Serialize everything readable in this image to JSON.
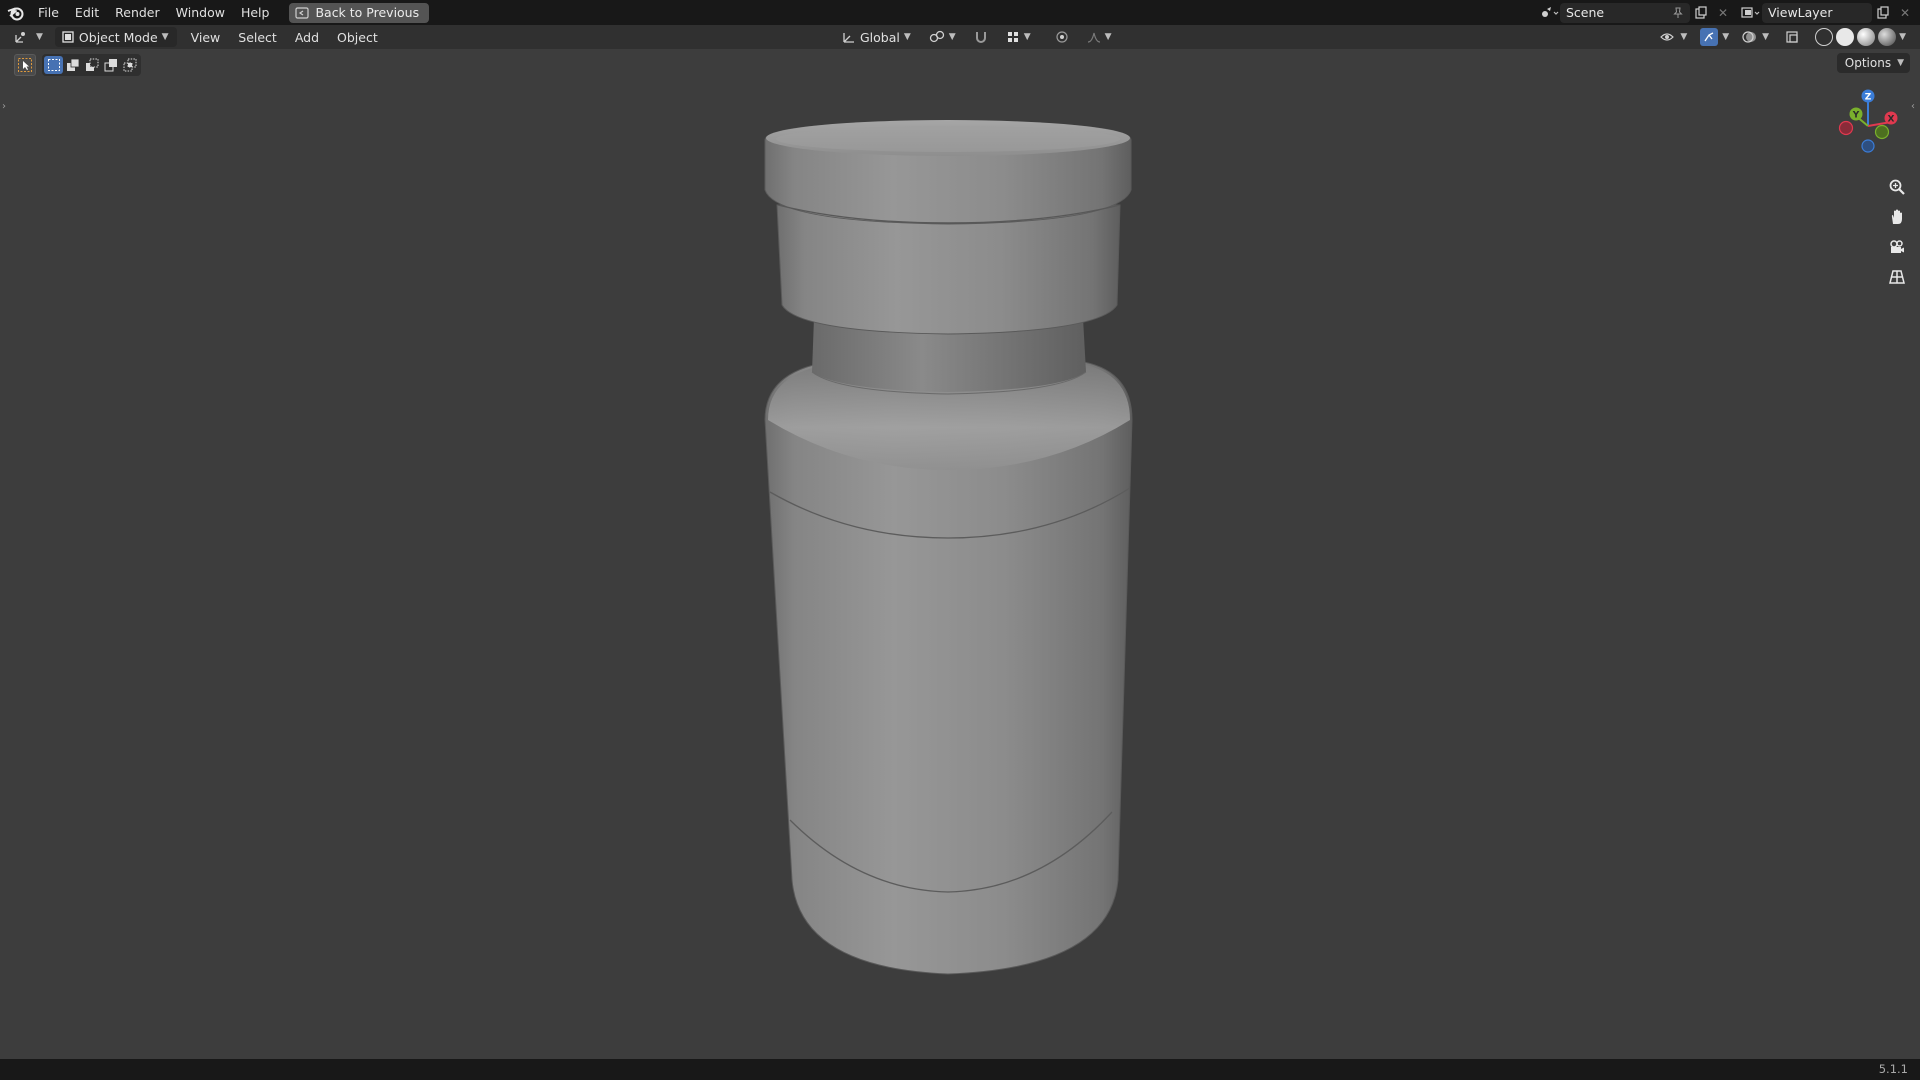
{
  "topbar": {
    "menus": [
      "File",
      "Edit",
      "Render",
      "Window",
      "Help"
    ],
    "back_label": "Back to Previous",
    "scene_name": "Scene",
    "view_layer": "ViewLayer"
  },
  "header": {
    "mode_label": "Object Mode",
    "menus": [
      "View",
      "Select",
      "Add",
      "Object"
    ],
    "orientation": "Global"
  },
  "toolbar": {
    "options_label": "Options"
  },
  "gizmo": {
    "x_label": "X",
    "y_label": "Y",
    "z_label": "Z",
    "x_color": "#e0394f",
    "y_color": "#7ab02c",
    "z_color": "#3b7dd8"
  },
  "status": {
    "version": "5.1.1"
  },
  "colors": {
    "topbar": "#181818",
    "header": "#303030",
    "viewport": "#3d3d3d",
    "accent": "#4772b3"
  }
}
